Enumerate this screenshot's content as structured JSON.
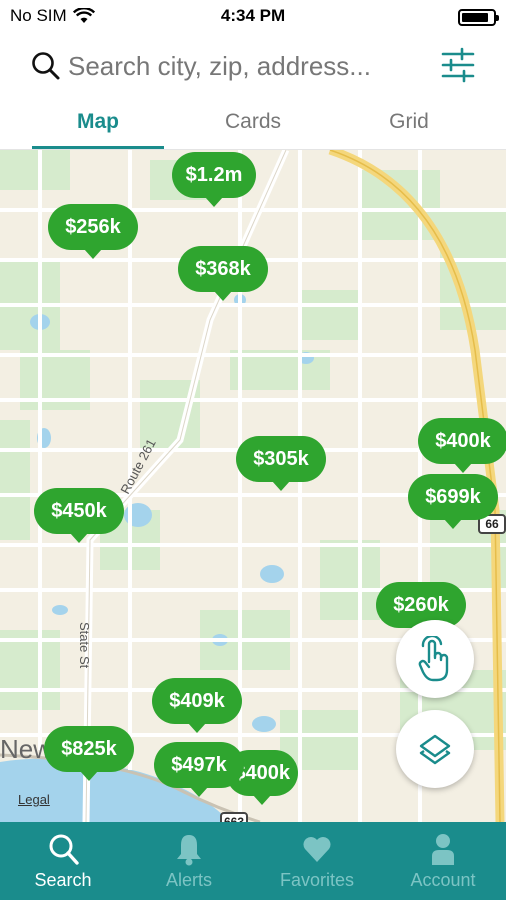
{
  "status_bar": {
    "carrier": "No SIM",
    "time": "4:34 PM",
    "battery_level": 0.85
  },
  "search": {
    "placeholder": "Search city, zip, address..."
  },
  "tabs": [
    {
      "label": "Map",
      "active": true
    },
    {
      "label": "Cards",
      "active": false
    },
    {
      "label": "Grid",
      "active": false
    }
  ],
  "map": {
    "road_labels": {
      "route": "Route 261",
      "street": "State St",
      "town": "Newp"
    },
    "shields": {
      "hwy_right": "66",
      "hwy_bottom": "663"
    },
    "legal": "Legal",
    "pins": [
      {
        "price": "$1.2m"
      },
      {
        "price": "$256k"
      },
      {
        "price": "$368k"
      },
      {
        "price": "$305k"
      },
      {
        "price": "$400k"
      },
      {
        "price": "$699k"
      },
      {
        "price": "$450k"
      },
      {
        "price": "$260k"
      },
      {
        "price": "$409k"
      },
      {
        "price": "$825k"
      },
      {
        "price": "$497k"
      },
      {
        "price": "$400k"
      }
    ]
  },
  "colors": {
    "accent": "#1a8c8c",
    "pin": "#2fa52f",
    "map_land": "#f3efe3",
    "map_park": "#cfe8c6",
    "water": "#9fd0ea"
  },
  "nav": [
    {
      "label": "Search",
      "icon": "search-icon",
      "active": true
    },
    {
      "label": "Alerts",
      "icon": "bell-icon",
      "active": false
    },
    {
      "label": "Favorites",
      "icon": "heart-icon",
      "active": false
    },
    {
      "label": "Account",
      "icon": "person-icon",
      "active": false
    }
  ]
}
